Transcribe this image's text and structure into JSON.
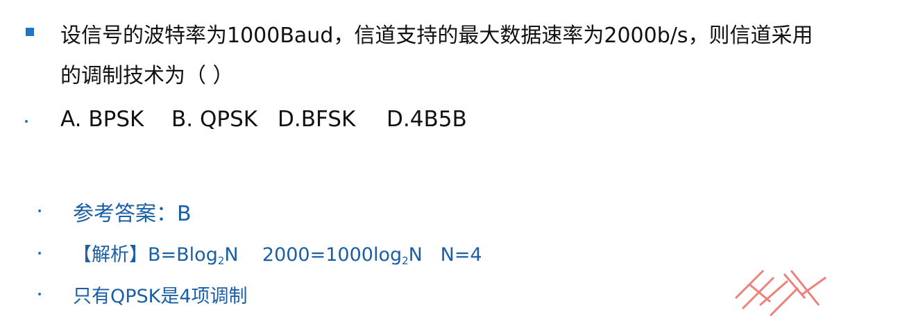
{
  "question": {
    "line1": "设信号的波特率为1000Baud，信道支持的最大数据速率为2000b/s，则信道采用",
    "line2": "的调制技术为（ ）"
  },
  "options": [
    {
      "label": "A. BPSK"
    },
    {
      "label": "B. QPSK"
    },
    {
      "label": "D.BFSK"
    },
    {
      "label": "D.4B5B"
    }
  ],
  "answer": {
    "reference": "参考答案：B",
    "analysis_prefix": "【解析】B=Blog",
    "analysis_sub1": "2",
    "analysis_mid": "N    2000=1000log",
    "analysis_sub2": "2",
    "analysis_end": "N   N=4",
    "note": "只有QPSK是4项调制"
  },
  "colors": {
    "accent": "#1f77c4",
    "answer_text": "#1a5fa6",
    "watermark": "#e8584e"
  },
  "icons": {
    "question_bullet": "square-bullet-icon",
    "list_bullet": "dot-bullet-icon"
  }
}
